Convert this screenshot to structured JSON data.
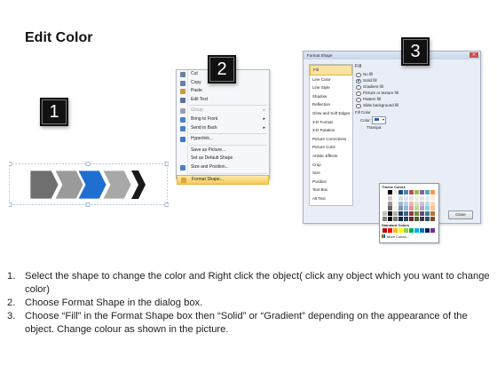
{
  "title": "Edit Color",
  "badges": [
    "1",
    "2",
    "3"
  ],
  "context_menu": {
    "items": [
      {
        "label": "Cut",
        "icon": "scissors-icon"
      },
      {
        "label": "Copy",
        "icon": "copy-icon"
      },
      {
        "label": "Paste",
        "icon": "paste-icon"
      },
      {
        "label": "Edit Text",
        "icon": "edit-text-icon"
      },
      {
        "label": "Group",
        "icon": "group-icon",
        "disabled": true,
        "submenu": true
      },
      {
        "label": "Bring to Front",
        "icon": "bring-front-icon",
        "submenu": true
      },
      {
        "label": "Send to Back",
        "icon": "send-back-icon",
        "submenu": true
      },
      {
        "label": "Hyperlink...",
        "icon": "hyperlink-icon"
      },
      {
        "label": "Save as Picture...",
        "icon": ""
      },
      {
        "label": "Set as Default Shape",
        "icon": ""
      },
      {
        "label": "Size and Position...",
        "icon": "size-position-icon"
      },
      {
        "label": "Format Shape...",
        "icon": "format-shape-icon",
        "highlighted": true
      }
    ]
  },
  "dialog": {
    "title": "Format Shape",
    "categories": [
      "Fill",
      "Line Color",
      "Line Style",
      "Shadow",
      "Reflection",
      "Glow and Soft Edges",
      "3-D Format",
      "3-D Rotation",
      "Picture Corrections",
      "Picture Color",
      "Artistic Effects",
      "Crop",
      "Size",
      "Position",
      "Text Box",
      "Alt Text"
    ],
    "selected_category": "Fill",
    "section_heading": "Fill",
    "options": [
      {
        "label": "No fill",
        "checked": false
      },
      {
        "label": "Solid fill",
        "checked": true
      },
      {
        "label": "Gradient fill",
        "checked": false
      },
      {
        "label": "Picture or texture fill",
        "checked": false
      },
      {
        "label": "Pattern fill",
        "checked": false
      },
      {
        "label": "Slide background fill",
        "checked": false
      }
    ],
    "fill_color_heading": "Fill Color",
    "color_label": "Color:",
    "transparency_label": "Transpa",
    "palette": {
      "theme_heading": "Theme Colors",
      "standard_heading": "Standard Colors",
      "more_colors": "More Colors...",
      "theme_top": [
        "#ffffff",
        "#000000",
        "#eeece1",
        "#1f497d",
        "#4f81bd",
        "#c0504d",
        "#9bbb59",
        "#8064a2",
        "#4bacc6",
        "#f79646"
      ],
      "standard": [
        "#c00000",
        "#ff0000",
        "#ffc000",
        "#ffff00",
        "#92d050",
        "#00b050",
        "#00b0f0",
        "#0070c0",
        "#002060",
        "#7030a0"
      ]
    },
    "close_label": "Close"
  },
  "shapes": {
    "colors": [
      "#6f6f6f",
      "#9a9a9a",
      "#1f6fd1",
      "#a8a8a8",
      "#1a1a1a"
    ]
  },
  "instructions": [
    {
      "num": "1.",
      "text": "Select the shape to change the color and Right click the object( click any object which you want to change color)"
    },
    {
      "num": "2.",
      "text": "Choose Format Shape in the dialog box."
    },
    {
      "num": "3.",
      "text": "Choose “Fill” in the Format Shape box then “Solid” or “Gradient” depending on the appearance of the object. Change colour as shown in the picture."
    }
  ]
}
